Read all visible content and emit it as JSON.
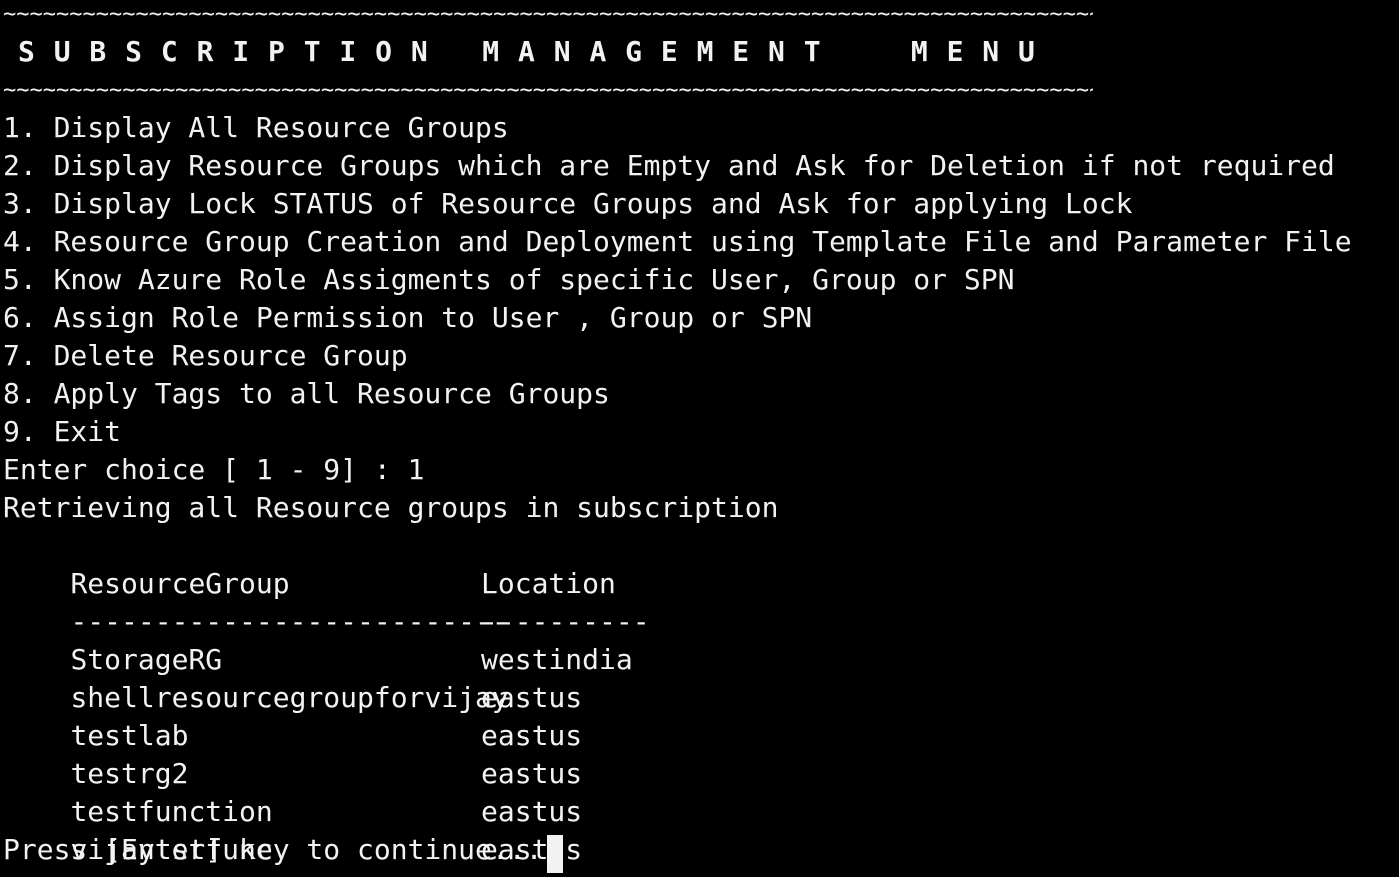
{
  "window": {
    "background": "#000000",
    "foreground": "#f2f2f2"
  },
  "banner": {
    "top_rule": "~~~~~~~~~~~~~~~~~~~~~~~~~~~~~~~~~~~~~~~~~~~~~~~~~~~~~~~~~~~~~~~~~~~~~~~~~~~~~~~~~~~~~~~~",
    "title": "S U B S C R I P T I O N   M A N A G E M E N T     M E N U",
    "bottom_rule": "~~~~~~~~~~~~~~~~~~~~~~~~~~~~~~~~~~~~~~~~~~~~~~~~~~~~~~~~~~~~~~~~~~~~~~~~~~~~~~~~~~~~~~~~"
  },
  "menu": {
    "items": [
      "1. Display All Resource Groups",
      "2. Display Resource Groups which are Empty and Ask for Deletion if not required",
      "3. Display Lock STATUS of Resource Groups and Ask for applying Lock",
      "4. Resource Group Creation and Deployment using Template File and Parameter File",
      "5. Know Azure Role Assigments of specific User, Group or SPN",
      "6. Assign Role Permission to User , Group or SPN",
      "7. Delete Resource Group",
      "8. Apply Tags to all Resource Groups",
      "9. Exit"
    ],
    "prompt": "Enter choice [ 1 - 9] : 1"
  },
  "output": {
    "status": "Retrieving all Resource groups in subscription",
    "columns": [
      "ResourceGroup",
      "Location"
    ],
    "separators": [
      "--------------------------",
      "----------"
    ],
    "rows": [
      [
        "StorageRG",
        "westindia"
      ],
      [
        "shellresourcegroupforvijay",
        "eastus"
      ],
      [
        "testlab",
        "eastus"
      ],
      [
        "testrg2",
        "eastus"
      ],
      [
        "testfunction",
        "eastus"
      ],
      [
        "vijaytstfunc",
        "eastus"
      ]
    ],
    "continue_prompt": "Press [Enter] key to continue..."
  }
}
